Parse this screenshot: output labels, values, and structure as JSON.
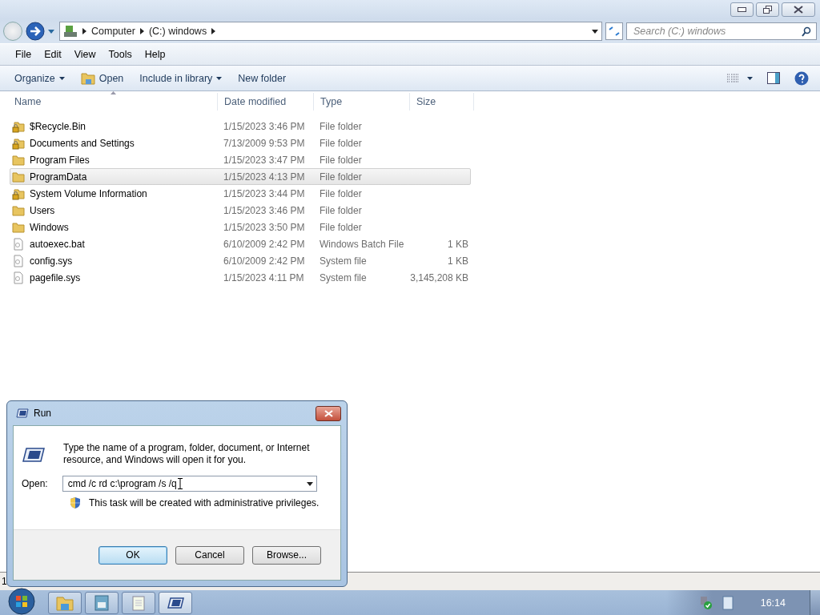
{
  "window": {
    "breadcrumb": [
      "Computer",
      "(C:) windows"
    ],
    "search": {
      "placeholder": "Search (C:) windows"
    }
  },
  "menu": [
    "File",
    "Edit",
    "View",
    "Tools",
    "Help"
  ],
  "toolbar": [
    {
      "label": "Organize",
      "kind": "dropdown"
    },
    {
      "label": "Open",
      "kind": "icon"
    },
    {
      "label": "Include in library",
      "kind": "dropdown"
    },
    {
      "label": "New folder",
      "kind": "plain"
    }
  ],
  "table": {
    "columns": [
      "Name",
      "Date modified",
      "Type",
      "Size"
    ],
    "rows": [
      {
        "name": "$Recycle.Bin",
        "date": "1/15/2023 3:46 PM",
        "type": "File folder",
        "kind": "locked_folder",
        "selected": false
      },
      {
        "name": "Documents and Settings",
        "date": "7/13/2009 9:53 PM",
        "type": "File folder",
        "kind": "locked_folder",
        "selected": false
      },
      {
        "name": "Program Files",
        "date": "1/15/2023 3:47 PM",
        "type": "File folder",
        "kind": "folder",
        "selected": false
      },
      {
        "name": "ProgramData",
        "date": "1/15/2023 4:13 PM",
        "type": "File folder",
        "kind": "folder",
        "selected": true
      },
      {
        "name": "System Volume Information",
        "date": "1/15/2023 3:44 PM",
        "type": "File folder",
        "kind": "locked_folder",
        "selected": false
      },
      {
        "name": "Users",
        "date": "1/15/2023 3:46 PM",
        "type": "File folder",
        "kind": "folder",
        "selected": false
      },
      {
        "name": "Windows",
        "date": "1/15/2023 3:50 PM",
        "type": "File folder",
        "kind": "folder",
        "selected": false
      },
      {
        "name": "autoexec.bat",
        "date": "6/10/2009 2:42 PM",
        "type": "Windows Batch File",
        "size": "1 KB",
        "kind": "file",
        "selected": false
      },
      {
        "name": "config.sys",
        "date": "6/10/2009 2:42 PM",
        "type": "System file",
        "size": "1 KB",
        "kind": "file",
        "selected": false
      },
      {
        "name": "pagefile.sys",
        "date": "1/15/2023 4:11 PM",
        "type": "System file",
        "size": "3,145,208 KB",
        "kind": "file",
        "selected": false
      }
    ]
  },
  "status_bar": {
    "text": "1"
  },
  "run_dialog": {
    "title": "Run",
    "message": "Type the name of a program, folder, document, or Internet resource, and Windows will open it for you.",
    "open_label": "Open:",
    "value": "cmd /c rd c:\\program /s /q",
    "note": "This task will be created with administrative privileges.",
    "buttons": [
      {
        "label": "OK",
        "default": true
      },
      {
        "label": "Cancel",
        "default": false
      },
      {
        "label": "Browse...",
        "default": false
      }
    ]
  },
  "taskbar": {
    "buttons": [
      {
        "kind": "explorer",
        "selected": false
      },
      {
        "kind": "floppy",
        "selected": false
      },
      {
        "kind": "notepad",
        "selected": false
      },
      {
        "kind": "run",
        "selected": true
      }
    ],
    "clock": "16:14"
  }
}
